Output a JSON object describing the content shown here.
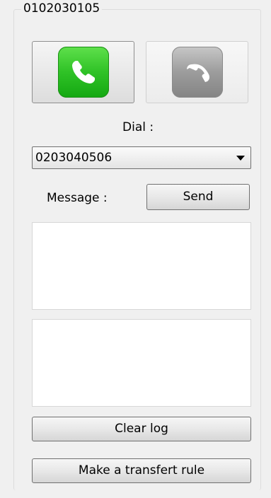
{
  "panel": {
    "title": "0102030105"
  },
  "call_controls": {
    "call_icon": "phone-icon",
    "hangup_icon": "hangup-phone-icon",
    "call_color": "#2fc226",
    "hangup_color": "#9c9c9c"
  },
  "dial": {
    "label": "Dial :",
    "selected_number": "0203040506"
  },
  "message": {
    "label": "Message :",
    "send_label": "Send"
  },
  "log": {
    "clear_label": "Clear log",
    "transfer_rule_label": "Make a transfert rule"
  }
}
